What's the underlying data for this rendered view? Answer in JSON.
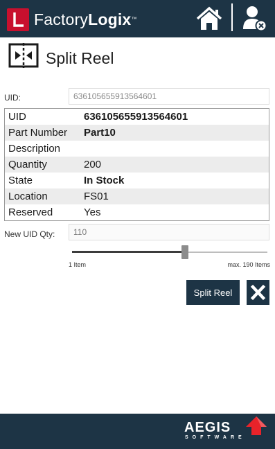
{
  "header": {
    "logo_letter": "L",
    "brand_prefix": "Factory",
    "brand_bold": "Logix",
    "brand_tm": "™",
    "home_icon": "home-icon",
    "user_icon": "user-remove-icon"
  },
  "page": {
    "title": "Split Reel",
    "title_icon": "split-reel-icon"
  },
  "uid_field": {
    "label": "UID:",
    "value": "636105655913564601"
  },
  "details": [
    {
      "key": "UID",
      "value": "636105655913564601",
      "bold": true
    },
    {
      "key": "Part Number",
      "value": "Part10",
      "bold": true
    },
    {
      "key": "Description",
      "value": "",
      "bold": false
    },
    {
      "key": "Quantity",
      "value": "200",
      "bold": false
    },
    {
      "key": "State",
      "value": "In Stock",
      "bold": true
    },
    {
      "key": "Location",
      "value": "FS01",
      "bold": false
    },
    {
      "key": "Reserved",
      "value": "Yes",
      "bold": false
    }
  ],
  "new_qty_field": {
    "label": "New UID Qty:",
    "value": "110"
  },
  "slider": {
    "min_label": "1 Item",
    "max_label": "max. 190 Items",
    "min": 1,
    "max": 190,
    "value": 110
  },
  "actions": {
    "split_label": "Split Reel",
    "close_icon": "close-icon"
  },
  "footer": {
    "brand": "AEGIS",
    "subtitle": "SOFTWARE"
  },
  "colors": {
    "header_bg": "#1d3445",
    "logo_red": "#c8102e",
    "row_alt": "#ececec"
  }
}
